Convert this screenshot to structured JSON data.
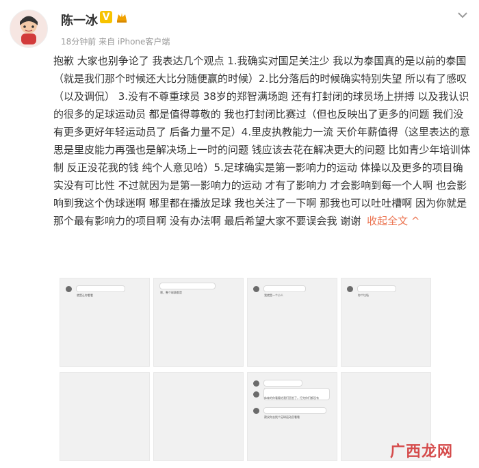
{
  "post": {
    "author_name": "陈一冰",
    "verified_badge": "V",
    "meta": "18分钟前 来自 iPhone客户端",
    "content": "抱歉 大家也别争论了 我表达几个观点 1.我确实对国足关注少 我以为泰国真的是以前的泰国（就是我们那个时候还大比分随便赢的时候）2.比分落后的时候确实特别失望 所以有了感叹（以及调侃） 3.没有不尊重球员 38岁的郑智满场跑 还有打封闭的球员场上拼搏 以及我认识的很多的足球运动员 都是值得尊敬的 我也打封闭比赛过（但也反映出了更多的问题 我们没有更多更好年轻运动员了 后备力量不足）4.里皮执教能力一流 天价年薪值得（这里表达的意思是里皮能力再强也是解决场上一时的问题 钱应该去花在解决更大的问题 比如青少年培训体制 反正没花我的钱 纯个人意见哈）5.足球确实是第一影响力的运动 体操以及更多的项目确实没有可比性 不过就因为是第一影响力的运动 才有了影响力 才会影响到每一个人啊 也会影响到我这个伪球迷啊 哪里都在播放足球 我也关注了一下啊 那我也可以吐吐槽啊 因为你就是那个最有影响力的项目啊 没有办法啊 最后希望大家不要误会我 谢谢",
    "collapse_label": "收起全文",
    "collapse_icon": "^"
  },
  "images": {
    "thumb1_text": "就是让你看看",
    "thumb2_text": "嗯，整个球赛都是",
    "thumb3_text": "我就是一个小人",
    "thumb4_text": "你个垃圾",
    "thumb7_line1": "好好的做事",
    "thumb7_line2": "体育的你看看给我们丢脸了，打完你们都没有",
    "thumb7_line3": "建议你去找个足球运动员看看",
    "watermark": "广西龙网"
  },
  "icons": {
    "more": "chevron-down-icon",
    "rank": "crown-icon",
    "avatar": "cartoon-avatar-icon"
  },
  "colors": {
    "accent": "#eb7350",
    "vbadge": "#f7c300",
    "watermark": "#d54b4b"
  }
}
